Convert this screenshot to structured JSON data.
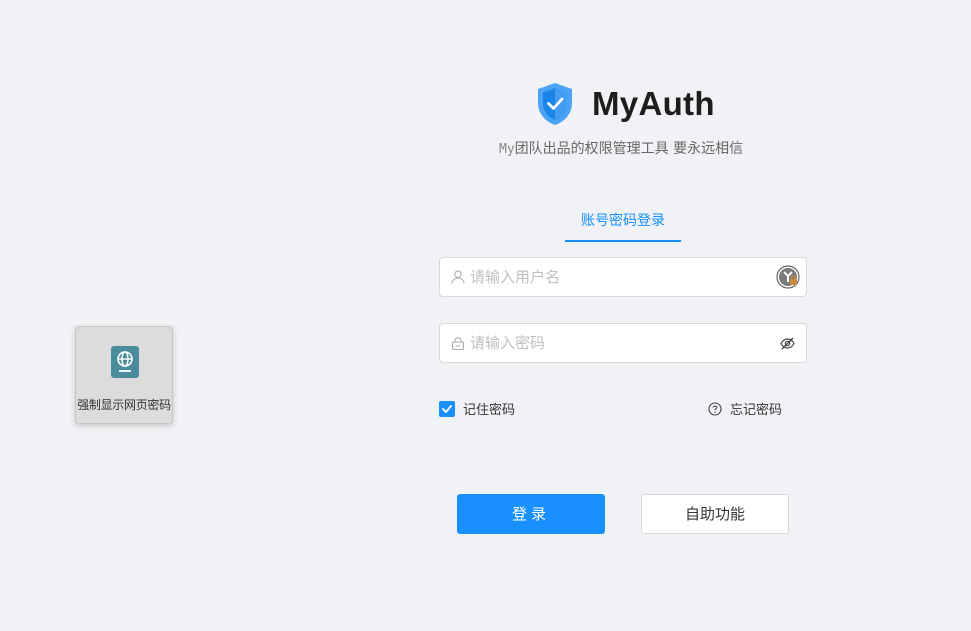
{
  "helper": {
    "label": "强制显示网页密码",
    "icon": "globe-card-icon"
  },
  "brand": {
    "title": "MyAuth",
    "subtitle_prefix": "My",
    "subtitle_rest": "团队出品的权限管理工具 要永远相信",
    "logo_icon": "shield-check-icon"
  },
  "tabs": [
    {
      "label": "账号密码登录",
      "active": true
    }
  ],
  "form": {
    "username": {
      "placeholder": "请输入用户名",
      "value": "",
      "prefix_icon": "user-icon",
      "suffix_icon": "password-manager-key-icon"
    },
    "password": {
      "placeholder": "请输入密码",
      "value": "",
      "prefix_icon": "lock-icon",
      "suffix_icon": "eye-slash-icon"
    },
    "remember": {
      "label": "记住密码",
      "checked": true
    },
    "forgot": {
      "label": "忘记密码",
      "icon": "question-circle-icon"
    }
  },
  "buttons": {
    "login": "登录",
    "self_service": "自助功能"
  },
  "colors": {
    "primary": "#1890ff",
    "background": "#f0f2f5",
    "helper_icon": "#4a8c9c"
  }
}
